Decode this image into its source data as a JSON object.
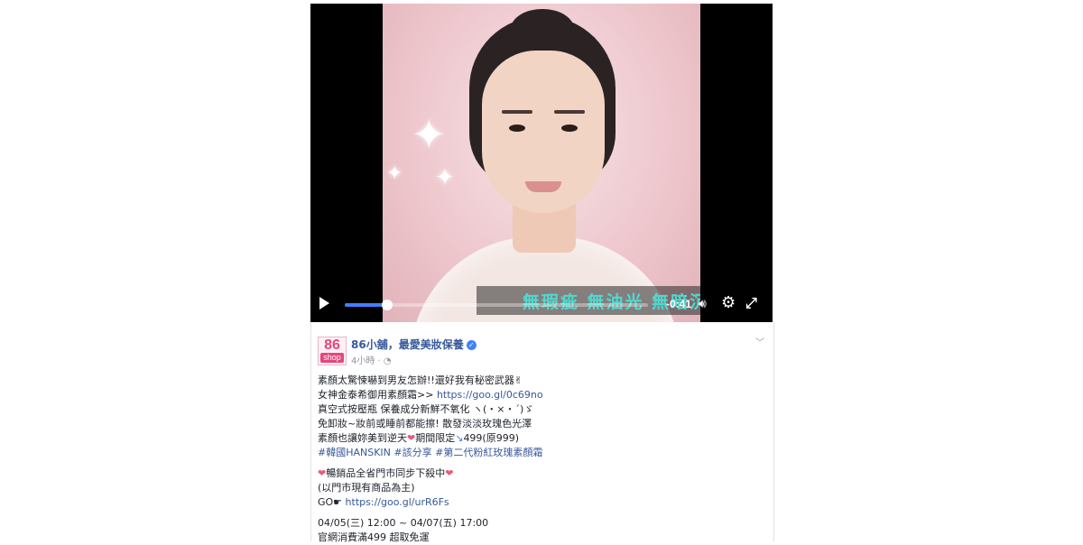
{
  "video": {
    "subtitle": "無瑕疵 無油光 無暗沉",
    "time_remaining": "-0:41",
    "progress": 0.14,
    "icons": [
      "play-icon",
      "volume-icon",
      "gear-icon",
      "expand-icon"
    ]
  },
  "post": {
    "logo_text_top": "86",
    "logo_text_bottom": "shop",
    "page_name": "86小舖，最愛美妝保養",
    "timestamp": "4小時 ·",
    "lines": [
      "素顏太驚悚嚇到男友怎辦!!還好我有秘密武器✌",
      "女神金泰希御用素顏霜>> ",
      "真空式按壓瓶 保養成分新鮮不氧化 ヽ(・×・´)ゞ",
      "免卸妝~妝前或睡前都能擦! 散發淡淡玫瑰色光澤",
      "素顏也讓妳美到逆天",
      "期間限定",
      "499(原999)"
    ],
    "link1": "https://goo.gl/0c69no",
    "hashtags": "#韓國HANSKIN #該分享 #第二代粉紅玫瑰素顏霜",
    "store_line": "暢銷品全省門市同步下殺中",
    "store_note": "(以門市現有商品為主)",
    "go_label": "GO☛ ",
    "link2": "https://goo.gl/urR6Fs",
    "dates": "04/05(三) 12:00 ~ 04/07(五) 17:00",
    "shipping": "官網消費滿499 超取免運"
  }
}
